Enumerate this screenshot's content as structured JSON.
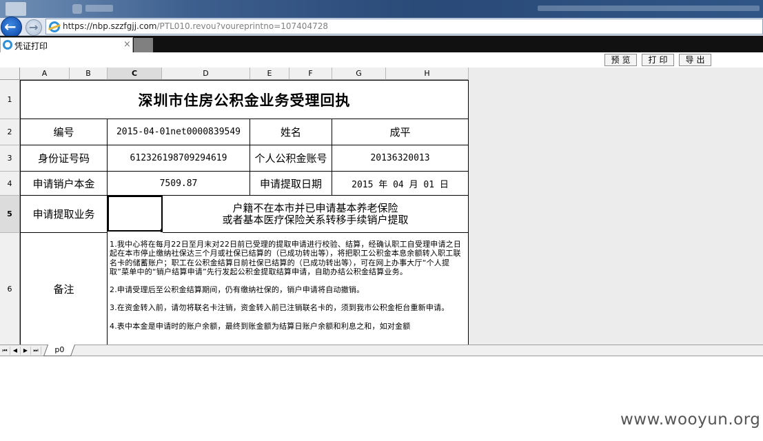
{
  "browser": {
    "url_host": "https://nbp.szzfgjj.com",
    "url_path": "/PTL010.revou?voureprintno=107404728",
    "tab_title": "凭证打印",
    "tab_close": "×",
    "back_glyph": "←",
    "forward_glyph": "→"
  },
  "toolbar": {
    "preview_label": "预览",
    "print_label": "打印",
    "export_label": "导出"
  },
  "sheet": {
    "columns": [
      "A",
      "B",
      "C",
      "D",
      "E",
      "F",
      "G",
      "H"
    ],
    "selected_column": "C",
    "rows": [
      "1",
      "2",
      "3",
      "4",
      "5",
      "6"
    ],
    "selected_row": "5",
    "tab_name": "p0",
    "nav_first": "⏮",
    "nav_prev": "◀",
    "nav_next": "▶",
    "nav_last": "⏭"
  },
  "receipt": {
    "title": "深圳市住房公积金业务受理回执",
    "serial_label": "编号",
    "serial_value": "2015-04-01net0000839549",
    "name_label": "姓名",
    "name_value": "成平",
    "id_label": "身份证号码",
    "id_value": "612326198709294619",
    "account_label": "个人公积金账号",
    "account_value": "20136320013",
    "principal_label": "申请销户本金",
    "principal_value": "7509.87",
    "date_label": "申请提取日期",
    "date_value": "2015 年 04 月 01 日",
    "business_label": "申请提取业务",
    "business_value_line1": "户籍不在本市并已申请基本养老保险",
    "business_value_line2": "或者基本医疗保险关系转移手续销户提取",
    "notes_label": "备注",
    "notes": [
      "1.我中心将在每月22日至月末对22日前已受理的提取申请进行校验、结算，经确认职工自受理申请之日起在本市停止缴纳社保达三个月或社保已结算的（已成功转出等），将把职工公积金本息余额转入职工联名卡的储蓄账户；职工在公积金结算日前社保已结算的（已成功转出等），可在网上办事大厅“个人提取”菜单中的“销户结算申请”先行发起公积金提取结算申请，自助办结公积金结算业务。",
      "2.申请受理后至公积金结算期间，仍有缴纳社保的，销户申请将自动撤销。",
      "3.在资金转入前，请勿将联名卡注销，资金转入前已注销联名卡的，须到我市公积金柜台重新申请。",
      "4.表中本金是申请时的账户余额，最终到账金额为结算日账户余额和利息之和，如对金额"
    ]
  },
  "watermark": "www.wooyun.org"
}
